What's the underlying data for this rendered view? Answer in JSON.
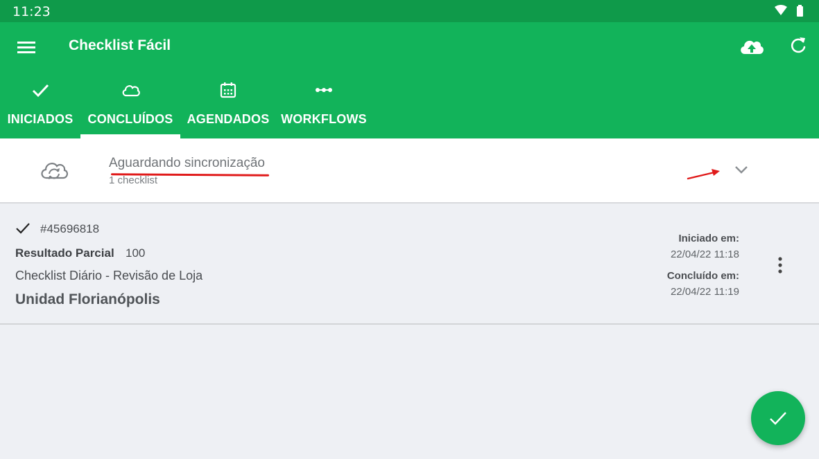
{
  "status_bar": {
    "time": "11:23"
  },
  "app_bar": {
    "title": "Checklist Fácil"
  },
  "tabs": [
    {
      "label": "INICIADOS",
      "icon": "check-icon"
    },
    {
      "label": "CONCLUÍDOS",
      "icon": "cloud-icon",
      "selected": true
    },
    {
      "label": "AGENDADOS",
      "icon": "calendar-icon"
    },
    {
      "label": "WORKFLOWS",
      "icon": "workflow-dots-icon"
    }
  ],
  "sync_group": {
    "title": "Aguardando sincronização",
    "count": "1 checklist",
    "icon": "cloud-sync-icon"
  },
  "checklist": {
    "id": "#45696818",
    "result_label": "Resultado Parcial",
    "result_value": "100",
    "name": "Checklist Diário - Revisão de Loja",
    "unit": "Unidad Florianópolis",
    "started_label": "Iniciado em:",
    "started_value": "22/04/22 11:18",
    "completed_label": "Concluído em:",
    "completed_value": "22/04/22 11:19"
  },
  "colors": {
    "primary": "#12b35a",
    "status_bar": "#0f9a4a",
    "annotation": "#e01b1b"
  }
}
